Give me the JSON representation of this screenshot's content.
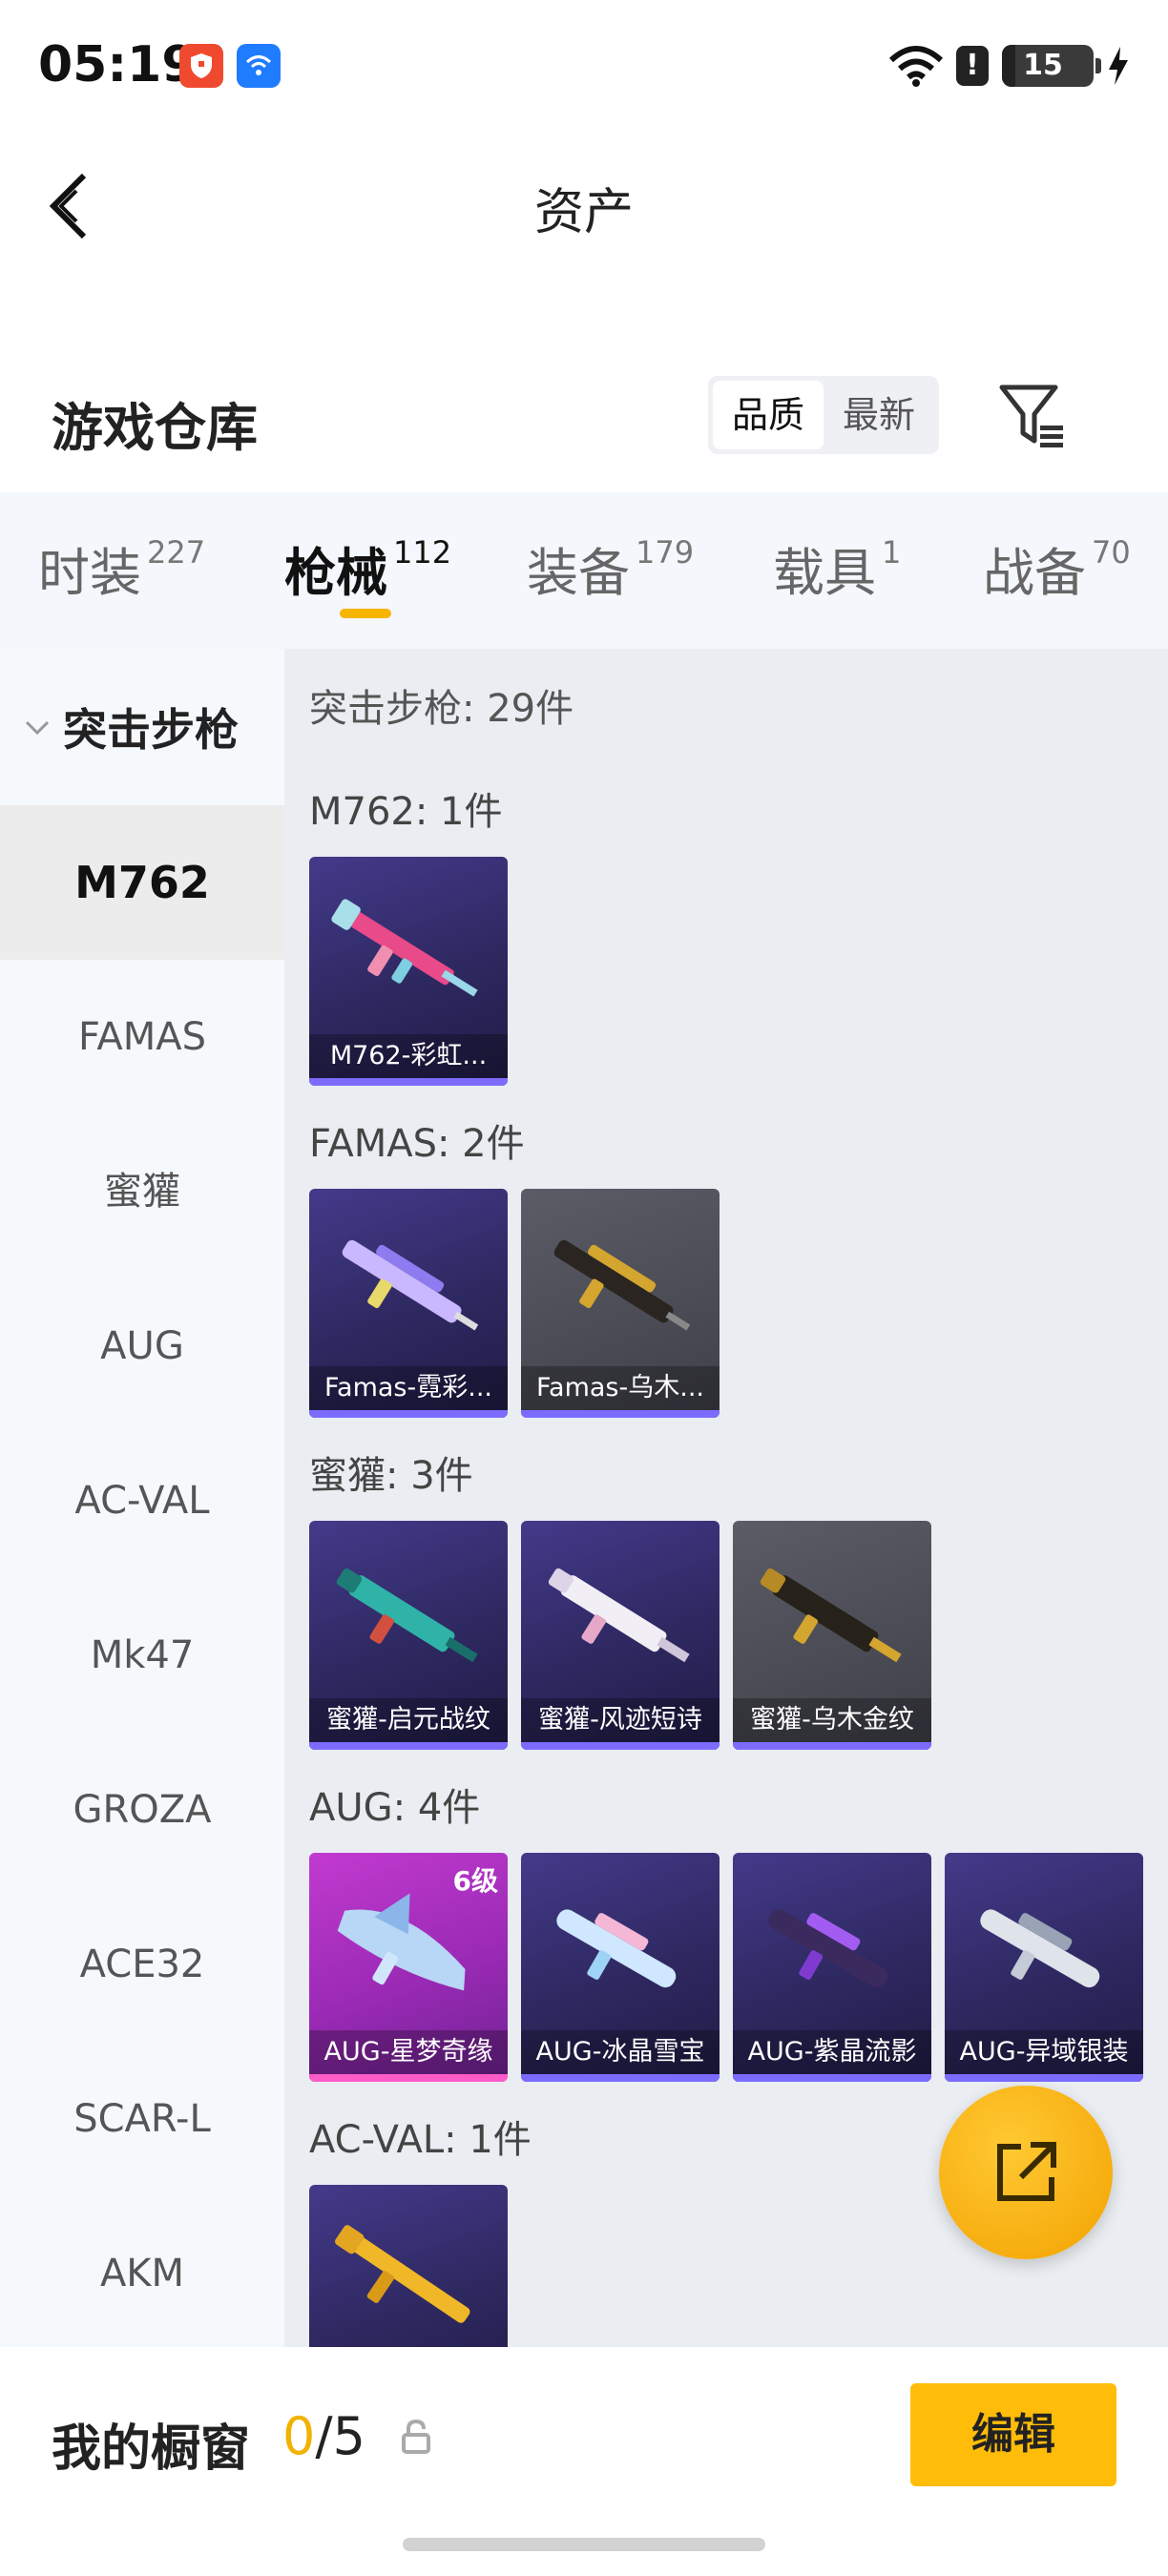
{
  "status_bar": {
    "time": "05:19",
    "alert": "!",
    "battery": "15"
  },
  "header": {
    "title": "资产"
  },
  "warehouse": {
    "title": "游戏仓库",
    "sort_options": [
      "品质",
      "最新"
    ],
    "active_sort": "品质"
  },
  "tabs": [
    {
      "label": "时装",
      "count": "227"
    },
    {
      "label": "枪械",
      "count": "112"
    },
    {
      "label": "装备",
      "count": "179"
    },
    {
      "label": "载具",
      "count": "1"
    },
    {
      "label": "战备",
      "count": "70"
    }
  ],
  "sidebar": {
    "group": "突击步枪",
    "items": [
      "M762",
      "FAMAS",
      "蜜獾",
      "AUG",
      "AC-VAL",
      "Mk47",
      "GROZA",
      "ACE32",
      "SCAR-L",
      "AKM"
    ],
    "active": "M762"
  },
  "content": {
    "summary": "突击步枪: 29件",
    "groups": [
      {
        "title": "M762: 1件",
        "items": [
          {
            "name": "M762-彩虹..."
          }
        ]
      },
      {
        "title": "FAMAS: 2件",
        "items": [
          {
            "name": "Famas-霓彩..."
          },
          {
            "name": "Famas-乌木..."
          }
        ]
      },
      {
        "title": "蜜獾: 3件",
        "items": [
          {
            "name": "蜜獾-启元战纹"
          },
          {
            "name": "蜜獾-风迹短诗"
          },
          {
            "name": "蜜獾-乌木金纹"
          }
        ]
      },
      {
        "title": "AUG: 4件",
        "items": [
          {
            "name": "AUG-星梦奇缘",
            "level": "6级"
          },
          {
            "name": "AUG-冰晶雪宝"
          },
          {
            "name": "AUG-紫晶流影"
          },
          {
            "name": "AUG-异域银装"
          }
        ]
      },
      {
        "title": "AC-VAL: 1件",
        "items": [
          {
            "name": ""
          }
        ]
      }
    ]
  },
  "showcase": {
    "label": "我的橱窗",
    "current": "0",
    "separator": "/",
    "max": "5",
    "edit_label": "编辑"
  },
  "colors": {
    "accent": "#ffbd0a",
    "tab_indicator": "#f7b500",
    "card_purple": "#2e2860",
    "card_gray": "#4a4b54",
    "card_pink": "#9a2ab5"
  }
}
